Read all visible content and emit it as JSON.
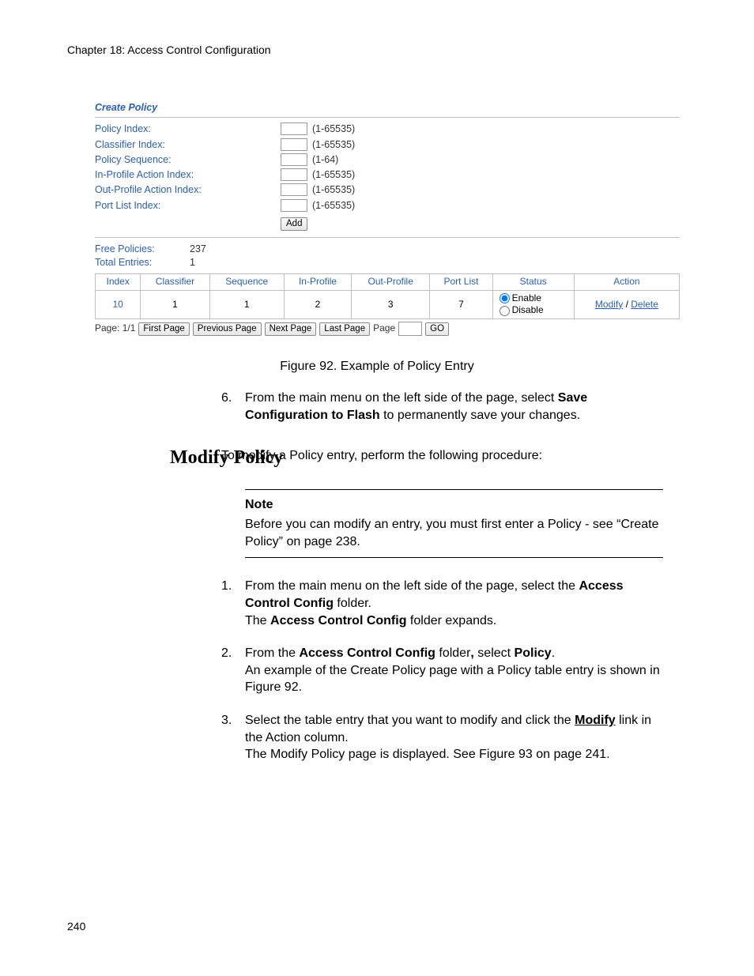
{
  "chapter_header": "Chapter 18: Access Control Configuration",
  "screenshot": {
    "title": "Create Policy",
    "fields": [
      {
        "label": "Policy Index:",
        "range": "(1-65535)"
      },
      {
        "label": "Classifier Index:",
        "range": "(1-65535)"
      },
      {
        "label": "Policy Sequence:",
        "range": "(1-64)"
      },
      {
        "label": "In-Profile Action Index:",
        "range": "(1-65535)"
      },
      {
        "label": "Out-Profile Action Index:",
        "range": "(1-65535)"
      },
      {
        "label": "Port List Index:",
        "range": "(1-65535)"
      }
    ],
    "add_button": "Add",
    "stats": {
      "free_label": "Free Policies:",
      "free_value": "237",
      "total_label": "Total Entries:",
      "total_value": "1"
    },
    "table": {
      "headers": [
        "Index",
        "Classifier",
        "Sequence",
        "In-Profile",
        "Out-Profile",
        "Port List",
        "Status",
        "Action"
      ],
      "row": {
        "index": "10",
        "classifier": "1",
        "sequence": "1",
        "in_profile": "2",
        "out_profile": "3",
        "port_list": "7",
        "status_enable": "Enable",
        "status_disable": "Disable",
        "action_modify": "Modify",
        "action_delete": "Delete"
      }
    },
    "pager": {
      "page_label": "Page: 1/1",
      "first": "First Page",
      "prev": "Previous Page",
      "next": "Next Page",
      "last": "Last Page",
      "page_word": "Page",
      "go": "GO"
    }
  },
  "figure_caption": "Figure 92. Example of Policy Entry",
  "step6_pre": "From the main menu on the left side of the page, select ",
  "step6_b1": "Save Configuration to Flash",
  "step6_post": " to permanently save your changes.",
  "modify_heading": "Modify Policy",
  "modify_intro": "To modify a Policy entry, perform the following procedure:",
  "note_title": "Note",
  "note_body": "Before you can modify an entry, you must first enter a Policy - see “Create Policy” on page 238.",
  "s1_a": "From the main menu on the left side of the page, select the ",
  "s1_b": "Access Control Config",
  "s1_c": " folder.",
  "s1_d": "The ",
  "s1_e": "Access Control Config",
  "s1_f": " folder expands.",
  "s2_a": "From the ",
  "s2_b": "Access Control Config",
  "s2_c": " folder",
  "s2_comma": ",",
  "s2_d": " select ",
  "s2_e": "Policy",
  "s2_f": ".",
  "s2_g": "An example of the Create Policy page with a Policy table entry is shown in Figure 92.",
  "s3_a": "Select the table entry that you want to modify and click the ",
  "s3_b": "Modify",
  "s3_c": " link in the Action column.",
  "s3_d": "The Modify Policy page is displayed. See Figure 93 on page 241.",
  "page_number": "240"
}
